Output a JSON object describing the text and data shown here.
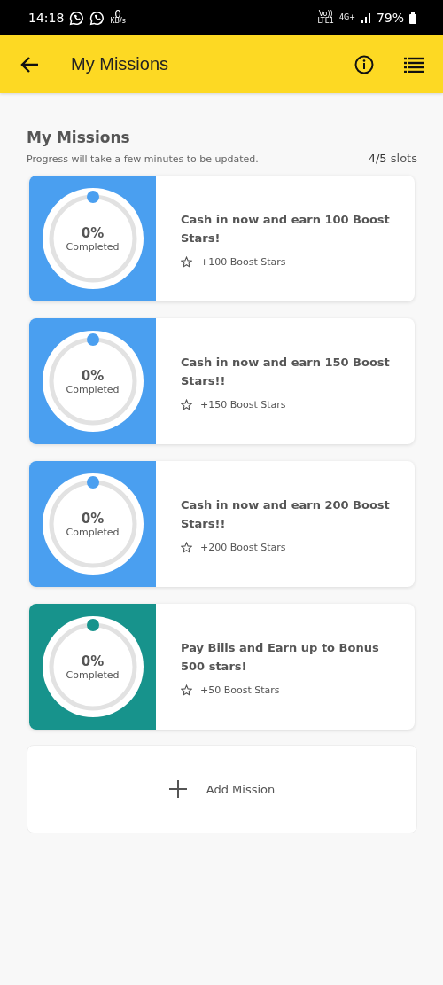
{
  "status_bar": {
    "time": "14:18",
    "net_speed": "0",
    "net_unit": "KB/s",
    "volte": "Vo))",
    "lte": "LTE1",
    "network": "4G+",
    "battery": "79%"
  },
  "app_bar": {
    "title": "My Missions"
  },
  "section": {
    "title": "My Missions",
    "subtitle": "Progress will take a few minutes to be updated.",
    "slots_count": "4/5",
    "slots_label": "slots"
  },
  "missions": [
    {
      "percent": "0%",
      "status": "Completed",
      "color": "#4a9ff0",
      "title": "Cash in now and earn 100 Boost Stars!",
      "reward": "+100 Boost Stars"
    },
    {
      "percent": "0%",
      "status": "Completed",
      "color": "#4a9ff0",
      "title": "Cash in now and earn 150 Boost Stars!!",
      "reward": "+150 Boost Stars"
    },
    {
      "percent": "0%",
      "status": "Completed",
      "color": "#4a9ff0",
      "title": "Cash in now and earn 200 Boost Stars!!",
      "reward": "+200 Boost Stars"
    },
    {
      "percent": "0%",
      "status": "Completed",
      "color": "#17938c",
      "title": "Pay Bills and Earn up to Bonus 500 stars!",
      "reward": "+50 Boost Stars"
    }
  ],
  "add_button": {
    "label": "Add Mission"
  }
}
